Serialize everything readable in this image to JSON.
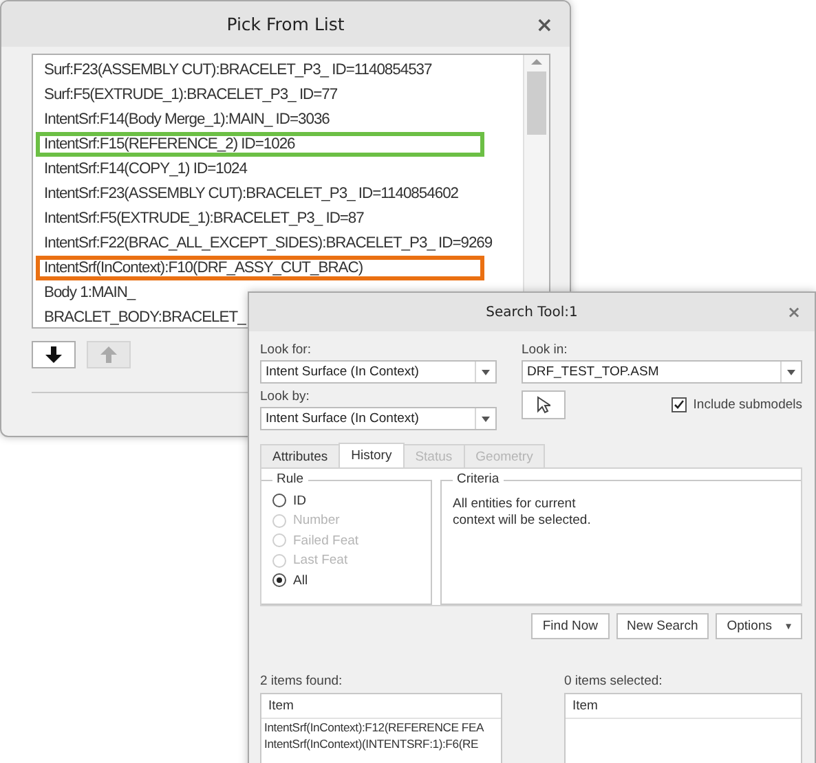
{
  "pick_window": {
    "title": "Pick From List",
    "close": "×",
    "items": [
      {
        "label": "Surf:F23(ASSEMBLY CUT):BRACELET_P3_ ID=1140854537"
      },
      {
        "label": "Surf:F5(EXTRUDE_1):BRACELET_P3_ ID=77"
      },
      {
        "label": "IntentSrf:F14(Body Merge_1):MAIN_ ID=3036"
      },
      {
        "label": "IntentSrf:F15(REFERENCE_2) ID=1026",
        "color": "#6cbf45"
      },
      {
        "label": "IntentSrf:F14(COPY_1) ID=1024"
      },
      {
        "label": "IntentSrf:F23(ASSEMBLY CUT):BRACELET_P3_ ID=1140854602"
      },
      {
        "label": "IntentSrf:F5(EXTRUDE_1):BRACELET_P3_ ID=87"
      },
      {
        "label": "IntentSrf:F22(BRAC_ALL_EXCEPT_SIDES):BRACELET_P3_ ID=9269"
      },
      {
        "label": "IntentSrf(InContext):F10(DRF_ASSY_CUT_BRAC)",
        "color": "#ea7012"
      },
      {
        "label": "Body 1:MAIN_"
      },
      {
        "label": "BRACLET_BODY:BRACELET_"
      }
    ],
    "buttons": [
      {
        "kind": "down",
        "disabled": false
      },
      {
        "kind": "up",
        "disabled": true
      }
    ]
  },
  "search_window": {
    "title": "Search Tool:1",
    "close": "×",
    "look_for": {
      "label": "Look for:",
      "value": "Intent Surface (In Context)"
    },
    "look_by": {
      "label": "Look by:",
      "value": "Intent Surface (In Context)"
    },
    "look_in": {
      "label": "Look in:",
      "value": "DRF_TEST_TOP.ASM"
    },
    "include_submodels": {
      "label": "Include submodels",
      "checked": true
    },
    "tabs": [
      {
        "label": "Attributes",
        "selected": false,
        "disabled": false
      },
      {
        "label": "History",
        "selected": true,
        "disabled": false
      },
      {
        "label": "Status",
        "selected": false,
        "disabled": true
      },
      {
        "label": "Geometry",
        "selected": false,
        "disabled": true
      }
    ],
    "rule": {
      "title": "Rule",
      "options": [
        {
          "label": "ID",
          "selected": false,
          "disabled": false
        },
        {
          "label": "Number",
          "selected": false,
          "disabled": true
        },
        {
          "label": "Failed Feat",
          "selected": false,
          "disabled": true
        },
        {
          "label": "Last Feat",
          "selected": false,
          "disabled": true
        },
        {
          "label": "All",
          "selected": true,
          "disabled": false
        }
      ]
    },
    "criteria": {
      "title": "Criteria",
      "text": "All entities for current context will be selected."
    },
    "actions": [
      "Find Now",
      "New Search"
    ],
    "options_button": {
      "label": "Options",
      "caret": "▾"
    },
    "found": {
      "label": "2 items found:",
      "column": "Item",
      "rows": [
        "IntentSrf(InContext):F12(REFERENCE FEA",
        "IntentSrf(InContext)(INTENTSRF:1):F6(RE"
      ]
    },
    "selected": {
      "label": "0 items selected:",
      "column": "Item"
    }
  }
}
